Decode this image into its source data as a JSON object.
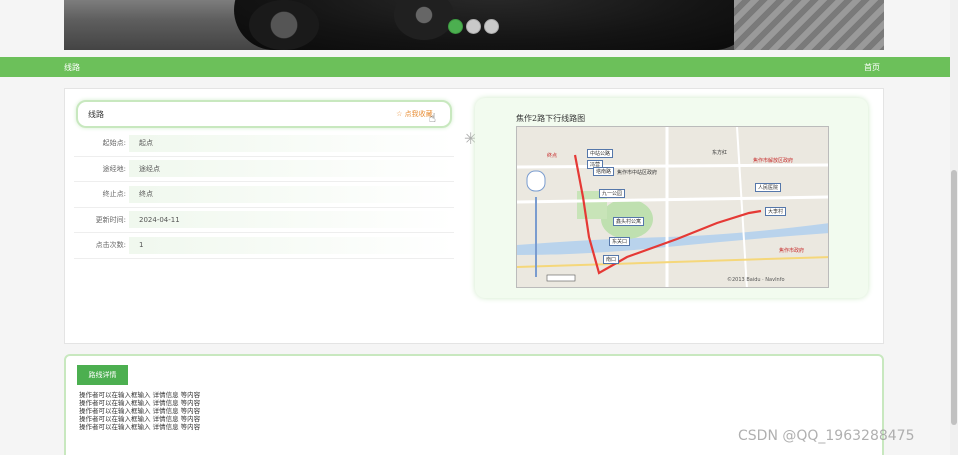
{
  "banner": {
    "slide_count": 3,
    "active_index": 0
  },
  "navbar": {
    "left_label": "线路",
    "right_label": "首页"
  },
  "route": {
    "name": "线路",
    "favorite_label": "☆ 点我收藏",
    "fields": [
      {
        "label": "起始点:",
        "value": "起点"
      },
      {
        "label": "途经地:",
        "value": "途经点"
      },
      {
        "label": "终止点:",
        "value": "终点"
      },
      {
        "label": "更新时间:",
        "value": "2024-04-11"
      },
      {
        "label": "点击次数:",
        "value": "1"
      }
    ]
  },
  "map": {
    "title": "焦作2路下行线路图",
    "labels": [
      "终点",
      "中站公路",
      "冯营",
      "塔南路",
      "焦作市中站区政府",
      "东方红",
      "焦作市解放区政府",
      "九一公园",
      "鑫头村公寓",
      "人民医院",
      "东关口",
      "大李村",
      "南口",
      "焦作市政府"
    ],
    "copyright": "©2013 Baidu · NavInfo"
  },
  "detail": {
    "tab_label": "路线详情",
    "lines": [
      "操作者可以在输入框输入  详情信息  等内容",
      "操作者可以在输入框输入  详情信息  等内容",
      "操作者可以在输入框输入  详情信息  等内容",
      "操作者可以在输入框输入  详情信息  等内容",
      "操作者可以在输入框输入  详情信息  等内容"
    ]
  },
  "watermark": "CSDN @QQ_1963288475",
  "colors": {
    "accent": "#6cc05a",
    "tab": "#4caf50",
    "favorite": "#e8903a"
  }
}
